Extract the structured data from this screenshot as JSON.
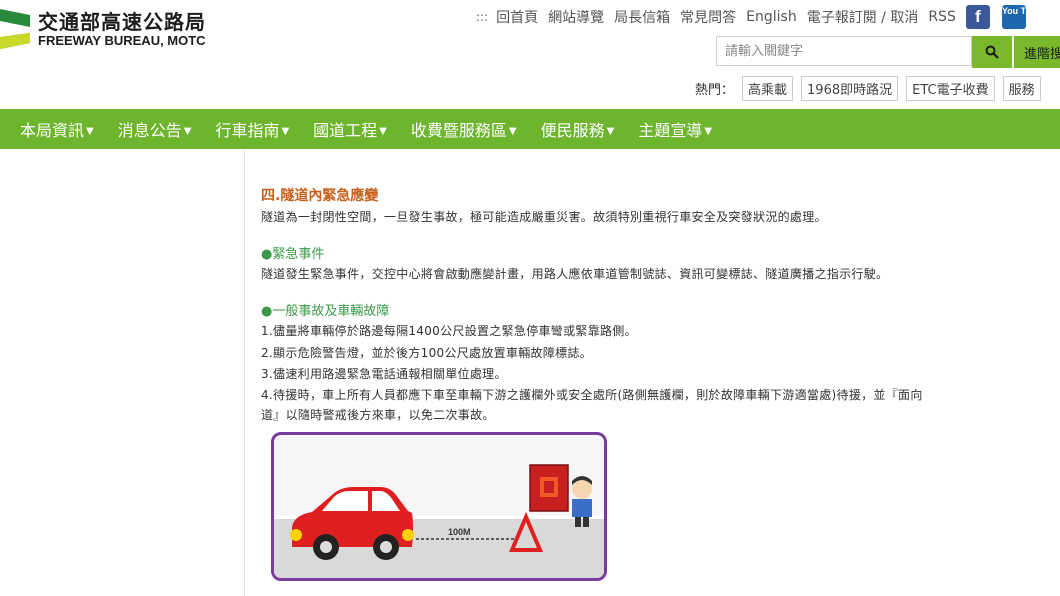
{
  "logo": {
    "zh": "交通部高速公路局",
    "en": "FREEWAY BUREAU, MOTC"
  },
  "toplinks": {
    "accesskey": ":::",
    "items": [
      "回首頁",
      "網站導覽",
      "局長信箱",
      "常見問答",
      "English",
      "電子報訂閱 / 取消",
      "RSS"
    ],
    "facebook": "f",
    "youtube": "You Tube"
  },
  "search": {
    "placeholder": "請輸入關鍵字",
    "advanced_label": "進階搜"
  },
  "hot": {
    "label": "熱門：",
    "tags": [
      "高乘載",
      "1968即時路況",
      "ETC電子收費",
      "服務"
    ]
  },
  "nav": [
    "本局資訊",
    "消息公告",
    "行車指南",
    "國道工程",
    "收費暨服務區",
    "便民服務",
    "主題宣導"
  ],
  "article": {
    "title": "四.隧道內緊急應變",
    "intro": "隧道為一封閉性空間，一旦發生事故，極可能造成嚴重災害。故須特別重視行車安全及突發狀況的處理。",
    "emergency_heading": "●緊急事件",
    "emergency_text": "隧道發生緊急事件，交控中心將會啟動應變計畫，用路人應依車道管制號誌、資訊可變標誌、隧道廣播之指示行駛。",
    "general_heading": "●一般事故及車輛故障",
    "steps": [
      "1.儘量將車輛停於路邊每隔1400公尺設置之緊急停車彎或緊靠路側。",
      "2.顯示危險警告燈，並於後方100公尺處放置車輛故障標誌。",
      "3.儘速利用路邊緊急電話通報相關單位處理。",
      "4.待援時，車上所有人員都應下車至車輛下游之護欄外或安全處所(路側無護欄，則於故障車輛下游適當處)待援，並『面向",
      "道』以隨時警戒後方來車，以免二次事故。"
    ],
    "illustration_label": "100M"
  }
}
